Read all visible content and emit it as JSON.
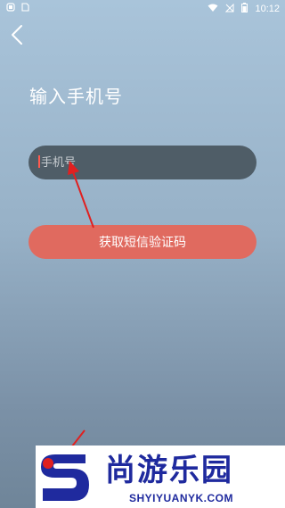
{
  "status_bar": {
    "time": "10:12",
    "icons": [
      "notification-icon",
      "sim-icon",
      "wifi-icon",
      "no-signal-icon",
      "battery-icon"
    ]
  },
  "page": {
    "title": "输入手机号"
  },
  "phone_input": {
    "placeholder": "手机号",
    "value": ""
  },
  "sms_button": {
    "label": "获取短信验证码"
  },
  "watermark": {
    "chinese": "尚游乐园",
    "english": "SHYIYUANYK.COM"
  },
  "colors": {
    "input_bg": "#4f5d67",
    "button_bg": "#e06a5f",
    "annotation_red": "#e02020",
    "watermark_blue": "#1f2a9e"
  }
}
